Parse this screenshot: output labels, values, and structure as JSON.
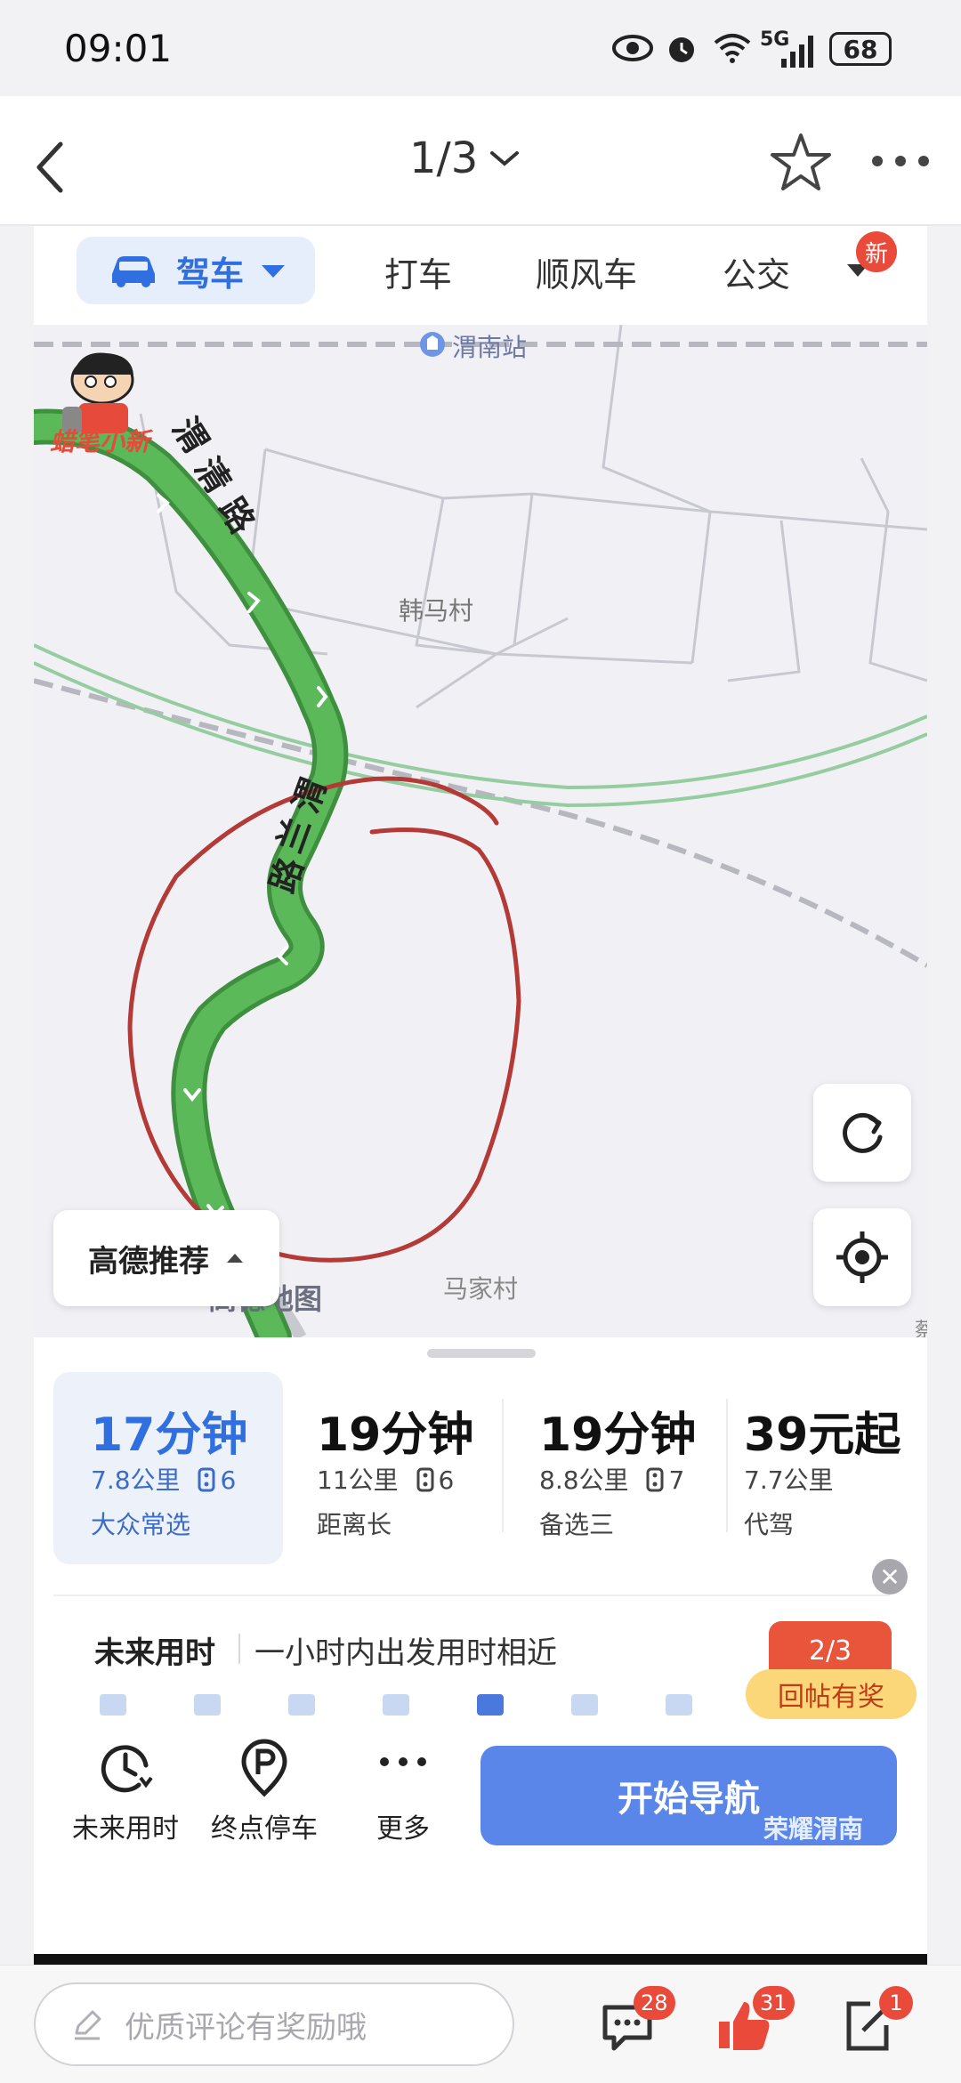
{
  "status_bar": {
    "time": "09:01",
    "network": "5G",
    "battery": "68"
  },
  "app_bar": {
    "page_indicator": "1/3"
  },
  "modes": {
    "drive": "驾车",
    "taxi": "打车",
    "carpool": "顺风车",
    "bus": "公交",
    "new_badge": "新"
  },
  "map": {
    "station_label": "渭南站",
    "village_label": "韩马村",
    "village2_label": "马家村",
    "road1": [
      "渭",
      "清",
      "路"
    ],
    "road2": [
      "渭",
      "兰",
      "路"
    ],
    "sticker_text": "蜡笔小新",
    "logo_text": "高德地图",
    "edge_text": "蔡",
    "recommend": "高德推荐"
  },
  "routes": [
    {
      "time": "17分钟",
      "distance": "7.8公里",
      "lights": "6",
      "tag": "大众常选"
    },
    {
      "time": "19分钟",
      "distance": "11公里",
      "lights": "6",
      "tag": "距离长"
    },
    {
      "time": "19分钟",
      "distance": "8.8公里",
      "lights": "7",
      "tag": "备选三"
    },
    {
      "time": "39元起",
      "distance": "7.7公里",
      "lights": "",
      "tag": "代驾"
    }
  ],
  "future": {
    "title": "未来用时",
    "description": "一小时内出发用时相近",
    "selected_slot": 5,
    "slots": 7
  },
  "post": {
    "page_badge": "2/3",
    "reward_label": "回帖有奖"
  },
  "actions": {
    "future_time": "未来用时",
    "end_parking": "终点停车",
    "more": "更多"
  },
  "start_nav": "开始导航",
  "watermark": "荣耀渭南",
  "comment_bar": {
    "placeholder": "优质评论有奖励哦",
    "comments_count": "28",
    "likes_count": "31",
    "share_count": "1"
  },
  "colors": {
    "accent": "#2f6fe0",
    "route": "#5cb95a",
    "circle": "#b33a36",
    "badge": "#e94a3a"
  }
}
